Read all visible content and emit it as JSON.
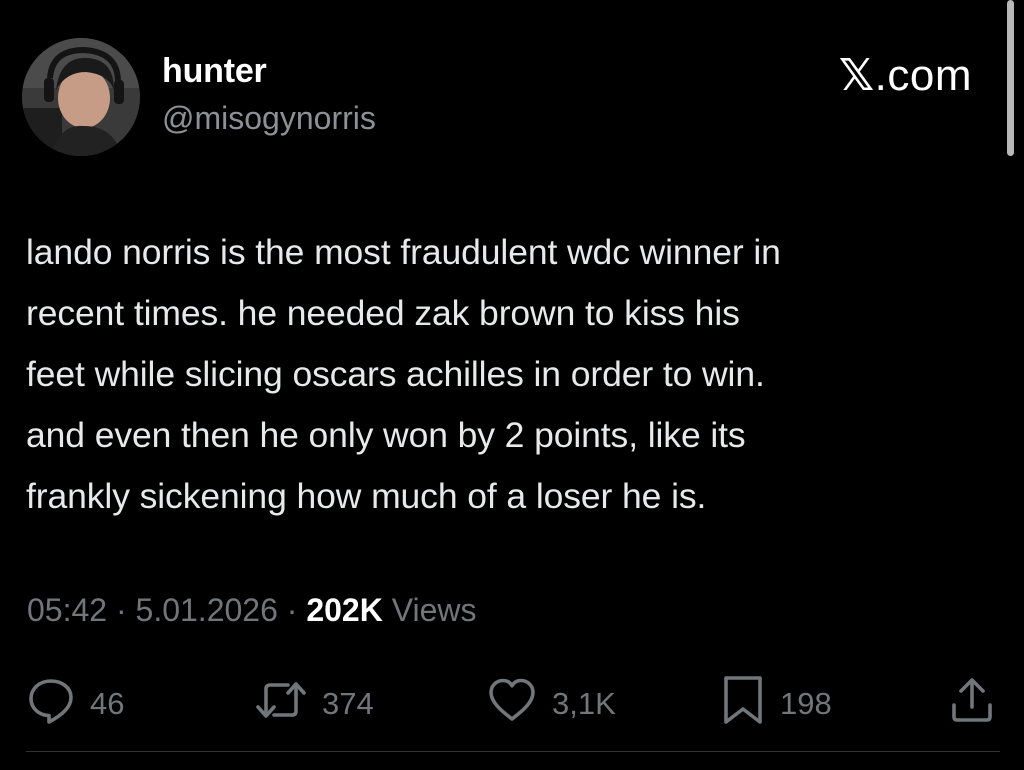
{
  "user": {
    "display_name": "hunter",
    "handle": "@misogynorris"
  },
  "brand": {
    "logo_glyph": "𝕏",
    "domain_suffix": ".com"
  },
  "tweet": {
    "text": "lando norris is the most fraudulent wdc winner in\nrecent times. he needed zak brown to kiss his\nfeet while slicing oscars achilles in order to win.\nand even then he only won by 2 points, like its\nfrankly sickening how much of a loser he is."
  },
  "meta": {
    "time": "05:42",
    "date": "5.01.2026",
    "separator": "·",
    "views_count": "202K",
    "views_label": "Views"
  },
  "actions": {
    "reply": {
      "icon": "reply-icon",
      "count": "46"
    },
    "repost": {
      "icon": "repost-icon",
      "count": "374"
    },
    "like": {
      "icon": "like-icon",
      "count": "3,1K"
    },
    "bookmark": {
      "icon": "bookmark-icon",
      "count": "198"
    },
    "share": {
      "icon": "share-icon"
    }
  },
  "colors": {
    "background": "#000000",
    "text_primary": "#e7e9ea",
    "text_secondary": "#71767b",
    "divider": "#2f3336"
  }
}
